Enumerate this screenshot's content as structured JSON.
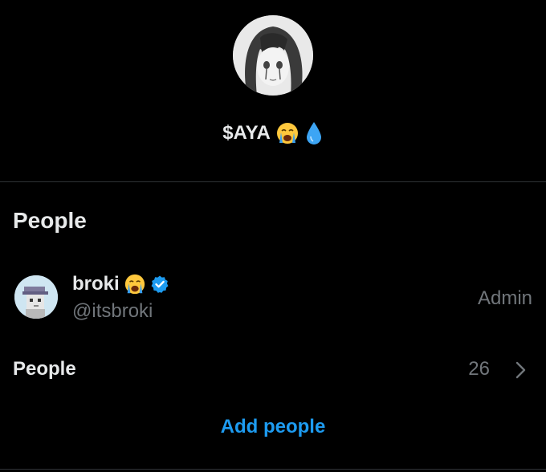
{
  "group": {
    "name": "$AYA",
    "avatar_icon": "anime-girl-avatar-icon",
    "name_emojis": [
      "loudly-crying-face-icon",
      "droplet-icon"
    ]
  },
  "people_section": {
    "title": "People",
    "members": [
      {
        "display_name": "broki",
        "name_emoji": "loudly-crying-face-icon",
        "verified": true,
        "handle": "@itsbroki",
        "role": "Admin",
        "avatar_icon": "pixel-punk-avatar-icon"
      }
    ],
    "people_row": {
      "label": "People",
      "count": "26",
      "chevron_icon": "chevron-right-icon"
    },
    "add_people_label": "Add people"
  },
  "colors": {
    "background": "#000000",
    "primary_text": "#e7e9ea",
    "secondary_text": "#71767b",
    "accent": "#1d9bf0",
    "divider": "#2f3336",
    "verified_badge": "#1d9bf0"
  }
}
